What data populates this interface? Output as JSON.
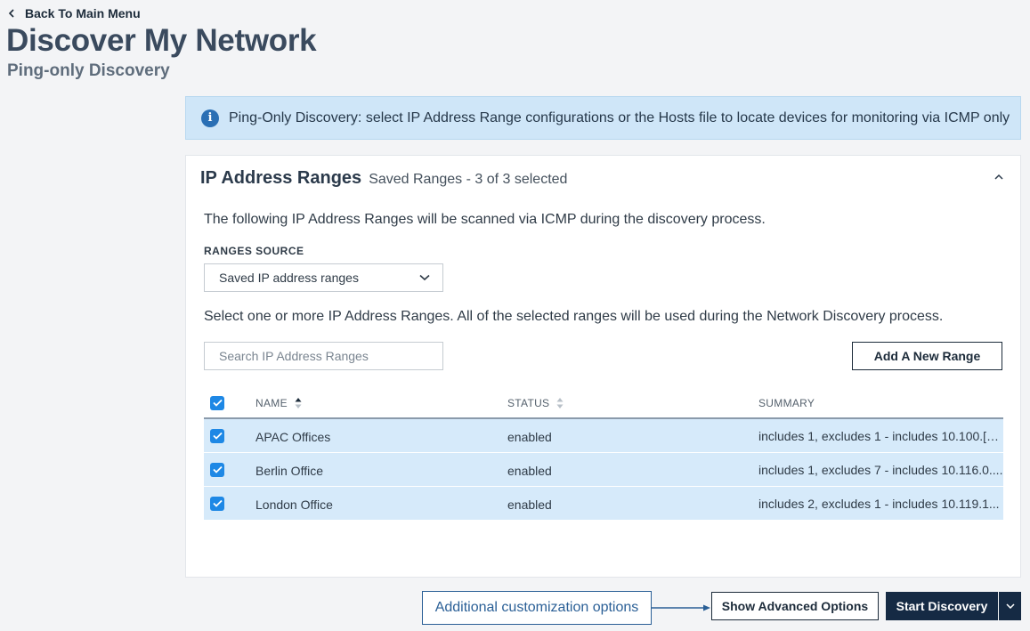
{
  "nav": {
    "back_label": "Back To Main Menu"
  },
  "page": {
    "title": "Discover My Network",
    "subtitle": "Ping-only Discovery"
  },
  "banner": {
    "text": "Ping-Only Discovery: select IP Address Range configurations or the Hosts file to locate devices for monitoring via ICMP only"
  },
  "panel": {
    "title": "IP Address Ranges",
    "selected_summary": "Saved Ranges - 3 of 3 selected",
    "intro": "The following IP Address Ranges will be scanned via ICMP during the discovery process.",
    "ranges_source_label": "RANGES SOURCE",
    "ranges_source_value": "Saved IP address ranges",
    "help": "Select one or more IP Address Ranges. All of the selected ranges will be used during the Network Discovery process.",
    "search_placeholder": "Search IP Address Ranges",
    "add_button": "Add A New Range"
  },
  "table": {
    "columns": {
      "name": "NAME",
      "status": "STATUS",
      "summary": "SUMMARY"
    },
    "rows": [
      {
        "name": "APAC Offices",
        "status": "enabled",
        "summary": "includes 1, excludes 1 - includes 10.100.[6..."
      },
      {
        "name": "Berlin Office",
        "status": "enabled",
        "summary": "includes 1, excludes 7 - includes 10.116.0...."
      },
      {
        "name": "London Office",
        "status": "enabled",
        "summary": "includes 2, excludes 1 - includes 10.119.1..."
      }
    ]
  },
  "footer": {
    "annotation": "Additional customization options",
    "advanced_button": "Show Advanced Options",
    "start_button": "Start Discovery"
  },
  "colors": {
    "banner_bg": "#cfe6f8",
    "row_selected_bg": "#d6eafa",
    "checkbox": "#1e88e5",
    "primary_button": "#152a44",
    "annotation": "#2a5f96"
  },
  "icons": {
    "back": "chevron-left-icon",
    "info": "info-icon",
    "collapse": "chevron-up-icon",
    "select": "chevron-down-icon",
    "checkbox": "checkmark-icon",
    "sort": "sort-icon"
  }
}
